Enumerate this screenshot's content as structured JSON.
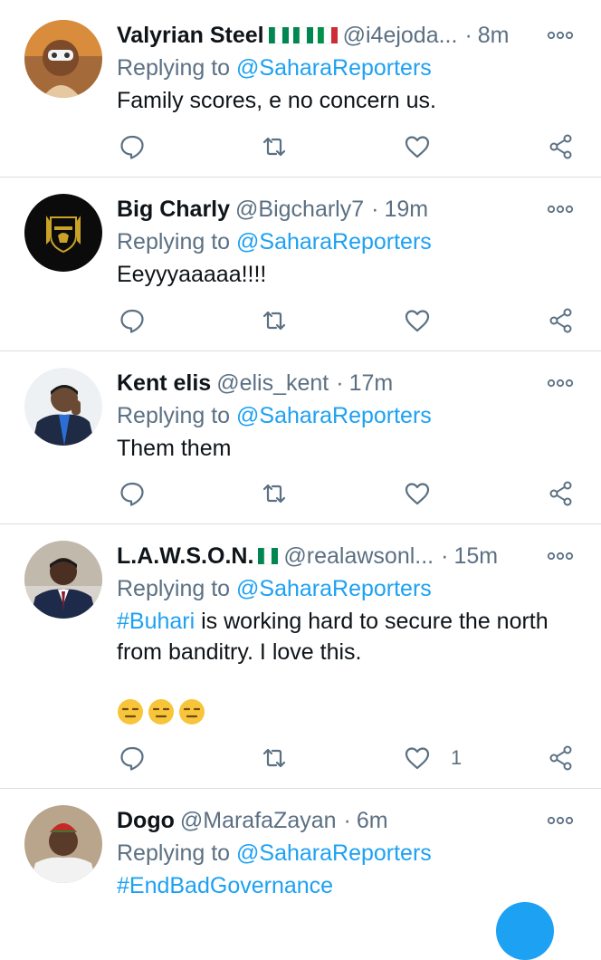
{
  "tweets": [
    {
      "name": "Valyrian Steel",
      "flags": [
        "ng",
        "ng",
        "it"
      ],
      "handle": "@i4ejoda...",
      "dot": "·",
      "time": "8m",
      "replying_prefix": "Replying to ",
      "replying_to": "@SaharaReporters",
      "text": "Family scores, e no concern us.",
      "likes": "",
      "avatar": "avatar-masked-person"
    },
    {
      "name": "Big Charly",
      "flags": [],
      "handle": "@Bigcharly7",
      "dot": "·",
      "time": "19m",
      "replying_prefix": "Replying to ",
      "replying_to": "@SaharaReporters",
      "text": "Eeyyyaaaaa!!!!",
      "likes": "",
      "avatar": "liverpool-crest"
    },
    {
      "name": "Kent elis",
      "flags": [],
      "handle": "@elis_kent",
      "dot": "·",
      "time": "17m",
      "replying_prefix": "Replying to ",
      "replying_to": "@SaharaReporters",
      "text": "Them them",
      "likes": "",
      "avatar": "avatar-man-suit-blue"
    },
    {
      "name": "L.A.W.S.O.N.",
      "flags": [
        "ng"
      ],
      "handle": "@realawsonl...",
      "dot": "·",
      "time": "15m",
      "replying_prefix": "Replying to ",
      "replying_to": "@SaharaReporters",
      "hashtag": "#Buhari",
      "text": " is working hard to secure the north from banditry. I love this.",
      "emojis": [
        "expressionless-face",
        "expressionless-face",
        "expressionless-face"
      ],
      "likes": "1",
      "avatar": "avatar-man-navy-suit"
    },
    {
      "name": "Dogo",
      "flags": [],
      "handle": "@MarafaZayan",
      "dot": "·",
      "time": "6m",
      "replying_prefix": "Replying to ",
      "replying_to": "@SaharaReporters",
      "hashtag": "#EndBadGovernance",
      "text": "",
      "likes": "",
      "avatar": "avatar-man-red-cap"
    }
  ],
  "colors": {
    "link": "#1da1f2",
    "secondary": "#5b7083",
    "divider": "#d9dde0",
    "nigeria_green": "#008751",
    "italy_red": "#ce2b37"
  },
  "icons": [
    "reply-icon",
    "retweet-icon",
    "like-icon",
    "share-icon",
    "more-icon"
  ]
}
